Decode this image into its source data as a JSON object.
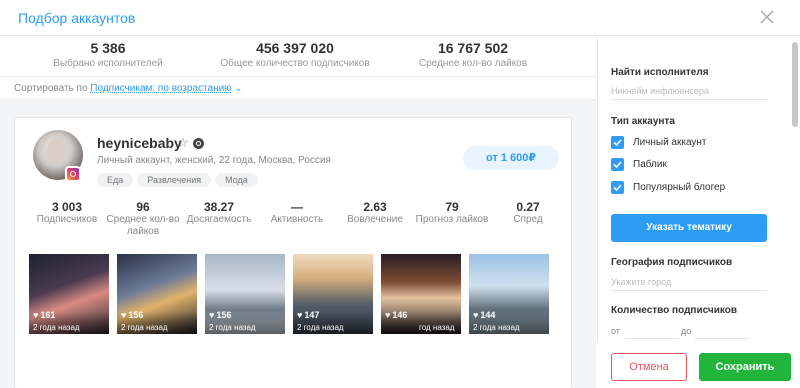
{
  "header": {
    "title": "Подбор аккаунтов"
  },
  "summary": [
    {
      "value": "5 386",
      "label": "Выбрано исполнителей"
    },
    {
      "value": "456 397 020",
      "label": "Общее количество подписчиков"
    },
    {
      "value": "16 767 502",
      "label": "Среднее кол-во лайков"
    }
  ],
  "sort": {
    "prefix": "Сортировать по",
    "value": "Подписчикам: по возрастанию"
  },
  "account": {
    "username": "heynicebaby",
    "description": "Личный аккаунт, женский, 22 года, Москва, Россия",
    "tags": [
      "Еда",
      "Развлечения",
      "Мода"
    ],
    "price": "от 1 600₽",
    "metrics": [
      {
        "value": "3 003",
        "label": "Подписчиков"
      },
      {
        "value": "96",
        "label": "Среднее кол-во лайков"
      },
      {
        "value": "38.27",
        "label": "Досягаемость"
      },
      {
        "value": "—",
        "label": "Активность"
      },
      {
        "value": "2.63",
        "label": "Вовлечение"
      },
      {
        "value": "79",
        "label": "Прогноз лайков"
      },
      {
        "value": "0.27",
        "label": "Спред"
      }
    ],
    "photos": [
      {
        "likes": "161",
        "ago": "2 года назад"
      },
      {
        "likes": "156",
        "ago": "2 года назад"
      },
      {
        "likes": "156",
        "ago": "2 года назад"
      },
      {
        "likes": "147",
        "ago": "2 года назад"
      },
      {
        "likes": "146",
        "ago": "год назад"
      },
      {
        "likes": "144",
        "ago": "2 года назад"
      }
    ]
  },
  "filters": {
    "search_title": "Найти исполнителя",
    "search_placeholder": "Никнейм инфлюенсера",
    "type_title": "Тип аккаунта",
    "types": [
      {
        "label": "Личный аккаунт",
        "checked": true
      },
      {
        "label": "Паблик",
        "checked": true
      },
      {
        "label": "Популярный блогер",
        "checked": true
      }
    ],
    "topic_button": "Указать тематику",
    "geo_title": "География подписчиков",
    "geo_placeholder": "Укажите город",
    "count_title": "Количество подписчиков",
    "from_label": "от",
    "to_label": "до"
  },
  "footer": {
    "cancel": "Отмена",
    "save": "Сохранить"
  },
  "colors": {
    "accent": "#2f9cf4",
    "save": "#22b53c",
    "cancel": "#e2555a"
  }
}
